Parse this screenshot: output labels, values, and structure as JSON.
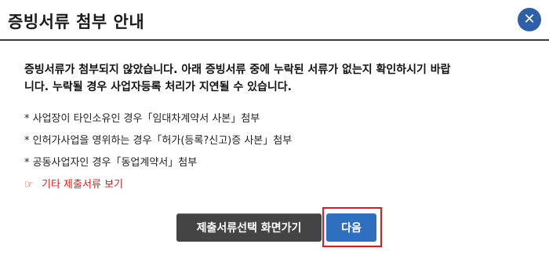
{
  "dialog": {
    "title": "증빙서류 첨부 안내",
    "close_label": "✕"
  },
  "body": {
    "line1": "증빙서류가 첨부되지 않았습니다. 아래 증빙서류 중에 누락된 서류가 없는지 확인하시기 바랍",
    "line2": "니다. 누락될 경우 사업자등록 처리가 지연될 수 있습니다.",
    "notes": [
      "* 사업장이 타인소유인 경우「임대차계약서 사본」첨부",
      "* 인허가사업을 영위하는 경우「허가(등록?신고)증 사본」첨부",
      "* 공동사업자인 경우「동업계약서」첨부"
    ],
    "more_pointer": "☞",
    "more_label": "기타 제출서류 보기"
  },
  "buttons": {
    "prev_label": "제출서류선택 화면가기",
    "next_label": "다음"
  },
  "colors": {
    "accent": "#2f6fc0",
    "close": "#2f5fa6",
    "dark_button": "#444444",
    "link_red": "#e0201a",
    "highlight": "#e01818"
  }
}
